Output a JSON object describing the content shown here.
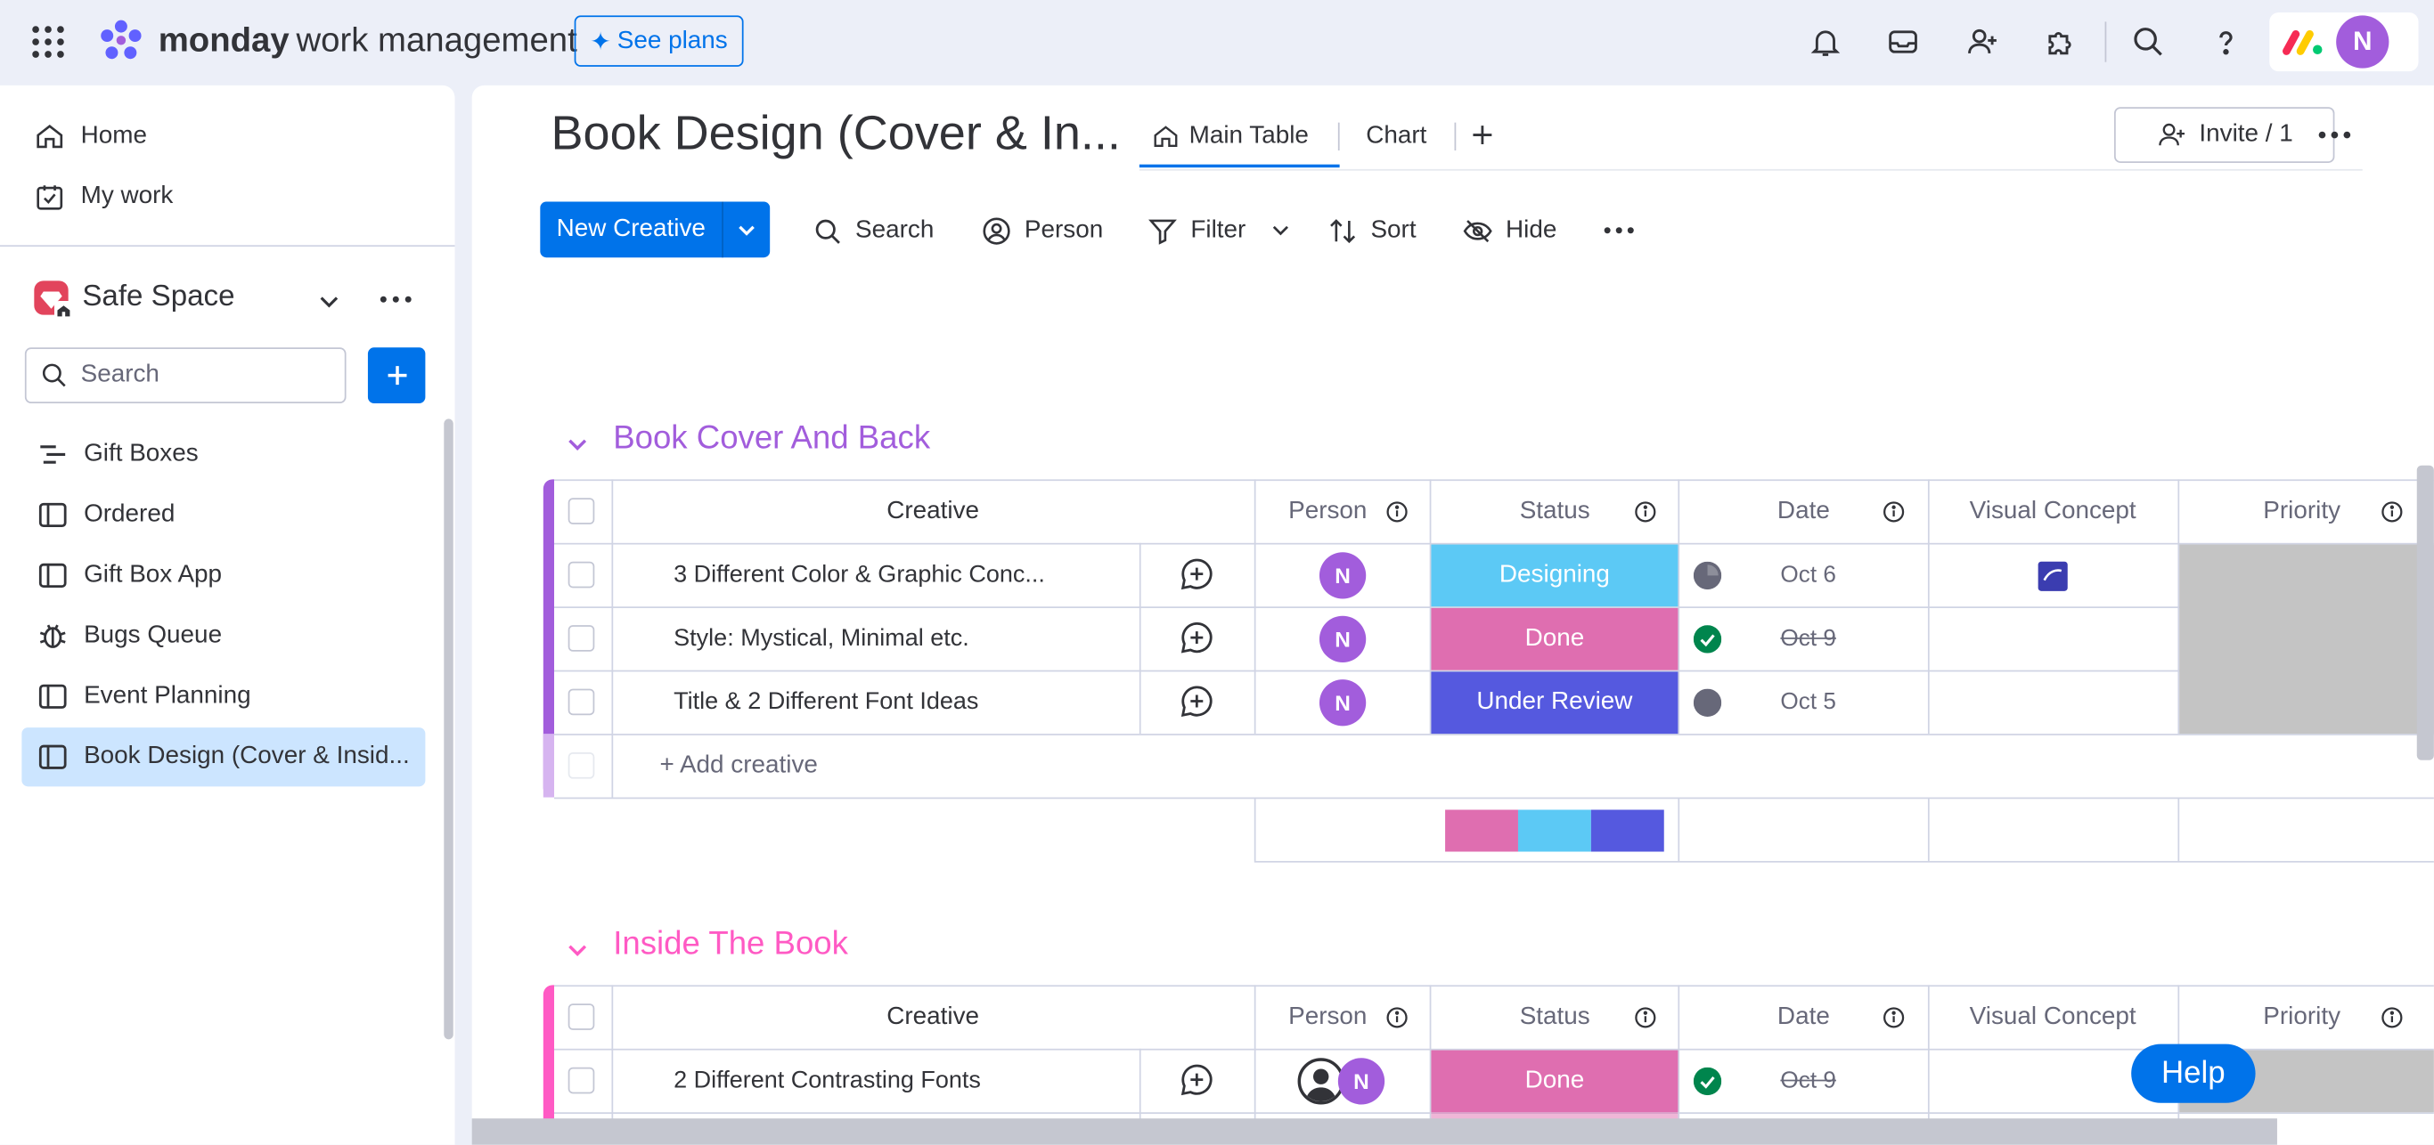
{
  "topbar": {
    "brand_bold": "monday",
    "brand_light": "work management",
    "see_plans": "See plans",
    "avatar_initial": "N"
  },
  "sidebar": {
    "home": "Home",
    "my_work": "My work",
    "workspace": "Safe Space",
    "search_placeholder": "Search",
    "boards": [
      {
        "label": "Gift Boxes",
        "icon": "timeline-icon"
      },
      {
        "label": "Ordered",
        "icon": "board-icon"
      },
      {
        "label": "Gift Box App",
        "icon": "board-icon"
      },
      {
        "label": "Bugs Queue",
        "icon": "bug-icon"
      },
      {
        "label": "Event Planning",
        "icon": "board-icon"
      },
      {
        "label": "Book Design (Cover & Insid...",
        "icon": "board-icon"
      }
    ]
  },
  "board": {
    "title": "Book Design (Cover & In...",
    "tabs": [
      "Main Table",
      "Chart"
    ],
    "invite": "Invite / 1"
  },
  "toolbar": {
    "new_item": "New Creative",
    "search": "Search",
    "person": "Person",
    "filter": "Filter",
    "sort": "Sort",
    "hide": "Hide"
  },
  "columns": {
    "creative": "Creative",
    "person": "Person",
    "status": "Status",
    "date": "Date",
    "visual": "Visual Concept",
    "priority": "Priority"
  },
  "groups": [
    {
      "title": "Book Cover And Back",
      "color": "#a25ddc",
      "add_item": "+ Add creative",
      "rows": [
        {
          "name": "3 Different Color & Graphic Conc...",
          "person": "N",
          "status": "Designing",
          "status_color": "#5cc9f5",
          "date": "Oct 6"
        },
        {
          "name": "Style: Mystical, Minimal etc.",
          "person": "N",
          "status": "Done",
          "status_color": "#df6eb0",
          "date": "Oct 9"
        },
        {
          "name": "Title & 2 Different Font Ideas",
          "person": "N",
          "status": "Under Review",
          "status_color": "#5559df",
          "date": "Oct 5"
        }
      ],
      "summary_fractions": [
        0.333,
        0.333,
        0.334
      ]
    },
    {
      "title": "Inside The Book",
      "color": "#ff5ac4",
      "rows": [
        {
          "name": "2 Different Contrasting Fonts",
          "person": "N",
          "status": "Done",
          "status_color": "#df6eb0",
          "date": "Oct 9"
        }
      ]
    }
  ],
  "help": "Help"
}
